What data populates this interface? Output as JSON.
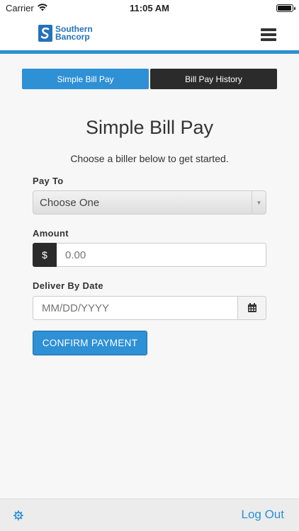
{
  "status_bar": {
    "carrier": "Carrier",
    "time": "11:05 AM",
    "battery_level": 1.0
  },
  "header": {
    "logo_line1": "Southern",
    "logo_line2": "Bancorp",
    "brand_color": "#2472b8",
    "menu_icon": "hamburger-menu-icon"
  },
  "tabs": [
    {
      "label": "Simple Bill Pay",
      "active": true
    },
    {
      "label": "Bill Pay History",
      "active": false
    }
  ],
  "main": {
    "title": "Simple Bill Pay",
    "subtitle": "Choose a biller below to get started."
  },
  "form": {
    "pay_to": {
      "label": "Pay To",
      "selected": "Choose One"
    },
    "amount": {
      "label": "Amount",
      "prefix": "$",
      "placeholder": "0.00"
    },
    "deliver_by": {
      "label": "Deliver By Date",
      "placeholder": "MM/DD/YYYY",
      "icon": "calendar-icon"
    },
    "confirm_label": "CONFIRM PAYMENT"
  },
  "footer": {
    "settings_icon": "gear-icon",
    "logout_label": "Log Out"
  },
  "colors": {
    "accent": "#2e90d5",
    "dark": "#2b2b2b"
  }
}
